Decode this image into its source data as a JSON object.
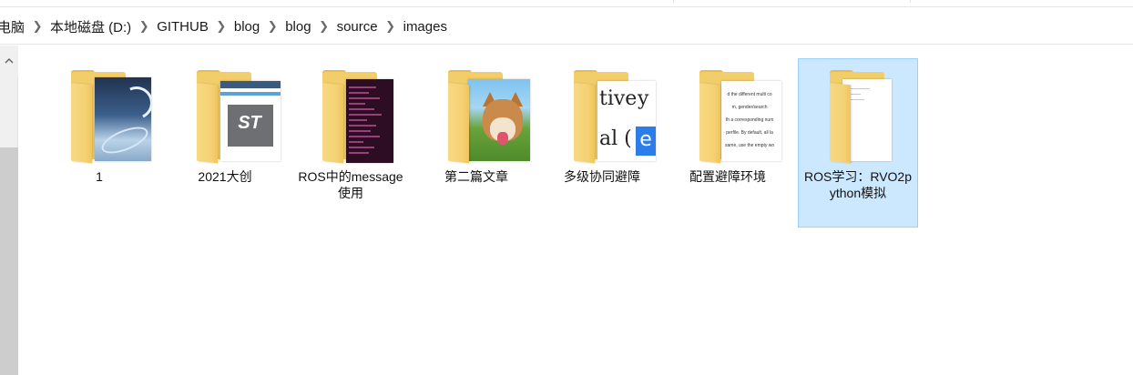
{
  "breadcrumb": {
    "items": [
      "电脑",
      "本地磁盘 (D:)",
      "GITHUB",
      "blog",
      "blog",
      "source",
      "images"
    ]
  },
  "files": [
    {
      "name": "1",
      "thumb": "space-image"
    },
    {
      "name": "2021大创",
      "thumb": "st-logo-screenshot"
    },
    {
      "name": "ROS中的message使用",
      "thumb": "terminal-screenshot"
    },
    {
      "name": "第二篇文章",
      "thumb": "dog-photo"
    },
    {
      "name": "多级协同避障",
      "thumb": "text-image"
    },
    {
      "name": "配置避障环境",
      "thumb": "document-screenshot"
    },
    {
      "name": "ROS学习：RVO2python模拟",
      "thumb": "blank-document",
      "selected": true
    }
  ],
  "thumb_text": {
    "st": "ST",
    "text_lines": [
      "tive",
      "y",
      "al (",
      "e"
    ],
    "doc_lines": [
      "d the different multi co",
      "m, gender/search",
      "th a corresponding num",
      "perfile. By default, all la",
      "same, use the empty wo"
    ]
  },
  "colors": {
    "selection_bg": "#cce8ff",
    "selection_border": "#99d1ff",
    "folder_yellow": "#f2cd6b"
  }
}
